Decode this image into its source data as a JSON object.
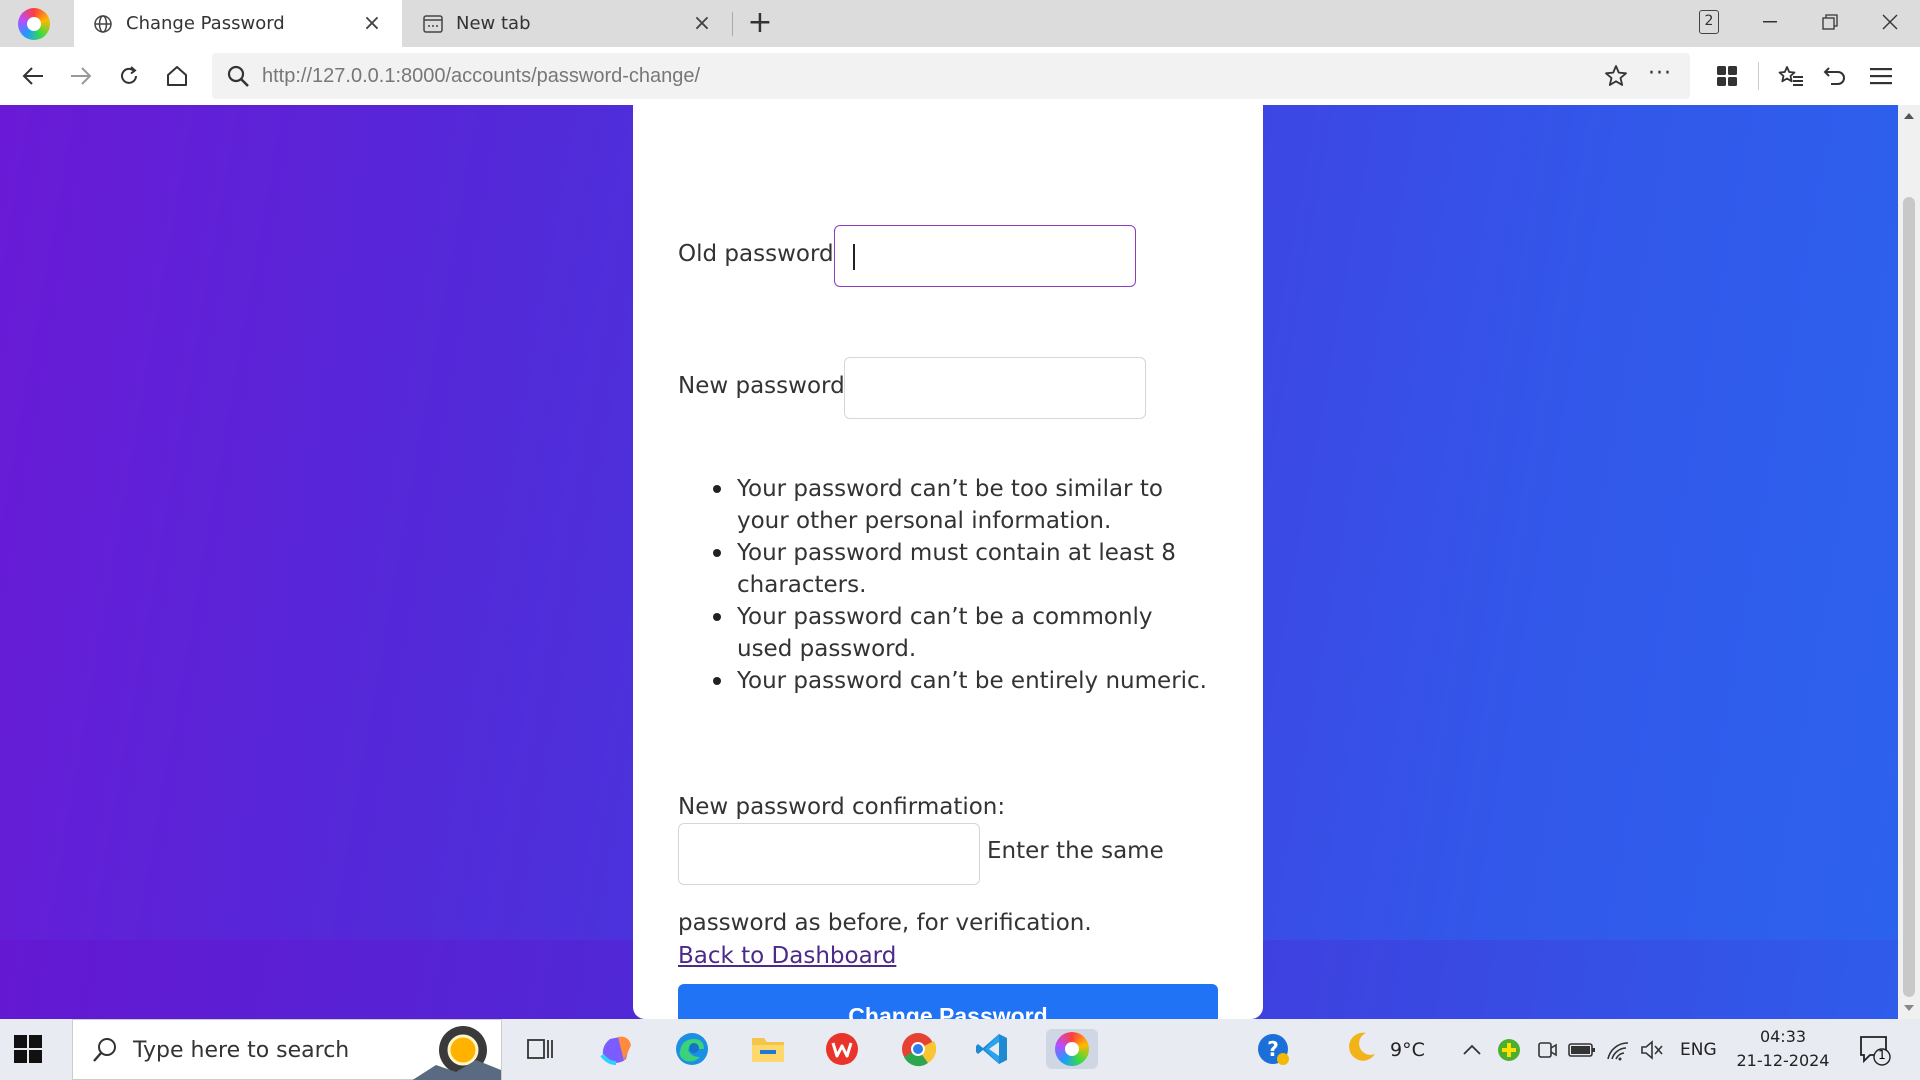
{
  "browser": {
    "tabs": [
      {
        "title": "Change Password",
        "active": true,
        "icon": "globe-icon"
      },
      {
        "title": "New tab",
        "active": false,
        "icon": "newtab-page-icon"
      }
    ],
    "tab_count": "2",
    "url_host": "http://127.0.0.1",
    "url_rest": ":8000/accounts/password-change/"
  },
  "form": {
    "old_password_label": "Old password:",
    "new_password_label": "New password:",
    "rules": [
      "Your password can’t be too similar to your other personal information.",
      "Your password must contain at least 8 characters.",
      "Your password can’t be a commonly used password.",
      "Your password can’t be entirely numeric."
    ],
    "confirm_label": "New password confirmation:",
    "confirm_help_part1": "Enter the same",
    "confirm_help_part2": "password as before, for verification.",
    "submit_label": "Change Password",
    "back_link": "Back to Dashboard"
  },
  "taskbar": {
    "search_placeholder": "Type here to search",
    "weather_temp": "9°C",
    "language": "ENG",
    "time": "04:33",
    "date": "21-12-2024",
    "notification_count": "1"
  },
  "colors": {
    "accent_button": "#2073f5",
    "focus_border": "#8a3fc0",
    "bg_gradient_start": "#6a1ad6",
    "bg_gradient_end": "#2c62ee"
  }
}
